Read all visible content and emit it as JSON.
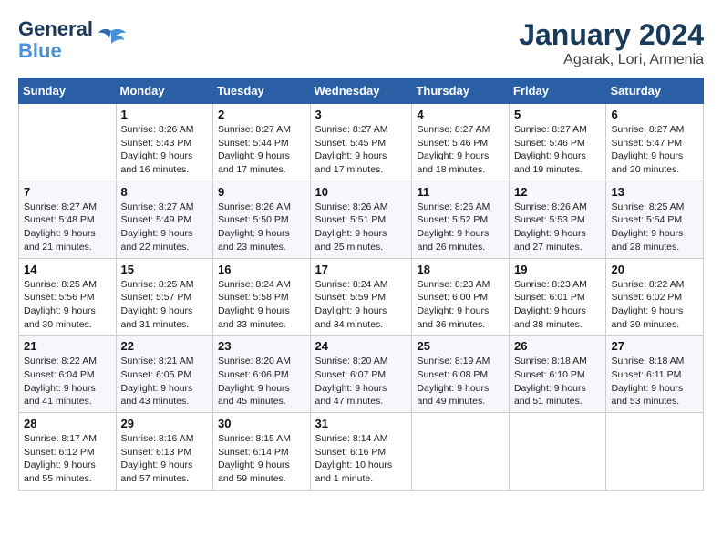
{
  "header": {
    "logo_line1": "General",
    "logo_line2": "Blue",
    "title": "January 2024",
    "subtitle": "Agarak, Lori, Armenia"
  },
  "columns": [
    "Sunday",
    "Monday",
    "Tuesday",
    "Wednesday",
    "Thursday",
    "Friday",
    "Saturday"
  ],
  "weeks": [
    [
      {
        "day": "",
        "info": ""
      },
      {
        "day": "1",
        "info": "Sunrise: 8:26 AM\nSunset: 5:43 PM\nDaylight: 9 hours\nand 16 minutes."
      },
      {
        "day": "2",
        "info": "Sunrise: 8:27 AM\nSunset: 5:44 PM\nDaylight: 9 hours\nand 17 minutes."
      },
      {
        "day": "3",
        "info": "Sunrise: 8:27 AM\nSunset: 5:45 PM\nDaylight: 9 hours\nand 17 minutes."
      },
      {
        "day": "4",
        "info": "Sunrise: 8:27 AM\nSunset: 5:46 PM\nDaylight: 9 hours\nand 18 minutes."
      },
      {
        "day": "5",
        "info": "Sunrise: 8:27 AM\nSunset: 5:46 PM\nDaylight: 9 hours\nand 19 minutes."
      },
      {
        "day": "6",
        "info": "Sunrise: 8:27 AM\nSunset: 5:47 PM\nDaylight: 9 hours\nand 20 minutes."
      }
    ],
    [
      {
        "day": "7",
        "info": "Sunrise: 8:27 AM\nSunset: 5:48 PM\nDaylight: 9 hours\nand 21 minutes."
      },
      {
        "day": "8",
        "info": "Sunrise: 8:27 AM\nSunset: 5:49 PM\nDaylight: 9 hours\nand 22 minutes."
      },
      {
        "day": "9",
        "info": "Sunrise: 8:26 AM\nSunset: 5:50 PM\nDaylight: 9 hours\nand 23 minutes."
      },
      {
        "day": "10",
        "info": "Sunrise: 8:26 AM\nSunset: 5:51 PM\nDaylight: 9 hours\nand 25 minutes."
      },
      {
        "day": "11",
        "info": "Sunrise: 8:26 AM\nSunset: 5:52 PM\nDaylight: 9 hours\nand 26 minutes."
      },
      {
        "day": "12",
        "info": "Sunrise: 8:26 AM\nSunset: 5:53 PM\nDaylight: 9 hours\nand 27 minutes."
      },
      {
        "day": "13",
        "info": "Sunrise: 8:25 AM\nSunset: 5:54 PM\nDaylight: 9 hours\nand 28 minutes."
      }
    ],
    [
      {
        "day": "14",
        "info": "Sunrise: 8:25 AM\nSunset: 5:56 PM\nDaylight: 9 hours\nand 30 minutes."
      },
      {
        "day": "15",
        "info": "Sunrise: 8:25 AM\nSunset: 5:57 PM\nDaylight: 9 hours\nand 31 minutes."
      },
      {
        "day": "16",
        "info": "Sunrise: 8:24 AM\nSunset: 5:58 PM\nDaylight: 9 hours\nand 33 minutes."
      },
      {
        "day": "17",
        "info": "Sunrise: 8:24 AM\nSunset: 5:59 PM\nDaylight: 9 hours\nand 34 minutes."
      },
      {
        "day": "18",
        "info": "Sunrise: 8:23 AM\nSunset: 6:00 PM\nDaylight: 9 hours\nand 36 minutes."
      },
      {
        "day": "19",
        "info": "Sunrise: 8:23 AM\nSunset: 6:01 PM\nDaylight: 9 hours\nand 38 minutes."
      },
      {
        "day": "20",
        "info": "Sunrise: 8:22 AM\nSunset: 6:02 PM\nDaylight: 9 hours\nand 39 minutes."
      }
    ],
    [
      {
        "day": "21",
        "info": "Sunrise: 8:22 AM\nSunset: 6:04 PM\nDaylight: 9 hours\nand 41 minutes."
      },
      {
        "day": "22",
        "info": "Sunrise: 8:21 AM\nSunset: 6:05 PM\nDaylight: 9 hours\nand 43 minutes."
      },
      {
        "day": "23",
        "info": "Sunrise: 8:20 AM\nSunset: 6:06 PM\nDaylight: 9 hours\nand 45 minutes."
      },
      {
        "day": "24",
        "info": "Sunrise: 8:20 AM\nSunset: 6:07 PM\nDaylight: 9 hours\nand 47 minutes."
      },
      {
        "day": "25",
        "info": "Sunrise: 8:19 AM\nSunset: 6:08 PM\nDaylight: 9 hours\nand 49 minutes."
      },
      {
        "day": "26",
        "info": "Sunrise: 8:18 AM\nSunset: 6:10 PM\nDaylight: 9 hours\nand 51 minutes."
      },
      {
        "day": "27",
        "info": "Sunrise: 8:18 AM\nSunset: 6:11 PM\nDaylight: 9 hours\nand 53 minutes."
      }
    ],
    [
      {
        "day": "28",
        "info": "Sunrise: 8:17 AM\nSunset: 6:12 PM\nDaylight: 9 hours\nand 55 minutes."
      },
      {
        "day": "29",
        "info": "Sunrise: 8:16 AM\nSunset: 6:13 PM\nDaylight: 9 hours\nand 57 minutes."
      },
      {
        "day": "30",
        "info": "Sunrise: 8:15 AM\nSunset: 6:14 PM\nDaylight: 9 hours\nand 59 minutes."
      },
      {
        "day": "31",
        "info": "Sunrise: 8:14 AM\nSunset: 6:16 PM\nDaylight: 10 hours\nand 1 minute."
      },
      {
        "day": "",
        "info": ""
      },
      {
        "day": "",
        "info": ""
      },
      {
        "day": "",
        "info": ""
      }
    ]
  ]
}
